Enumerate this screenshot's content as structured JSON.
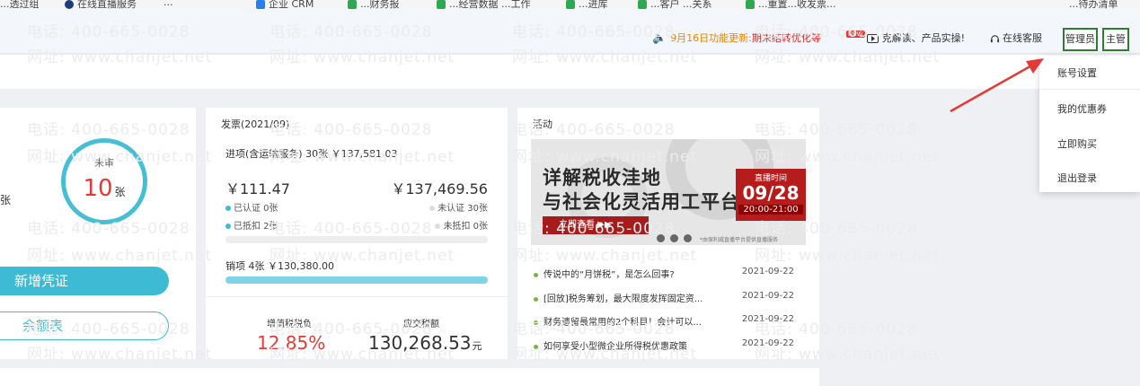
{
  "bookmarks": {
    "items": [
      "...透过组",
      "在线直播服务",
      "...",
      "企业 CRM",
      "...财务报",
      "...经营数据 ...工作",
      "...进库",
      "...客户 ...关系",
      "...重置...收发票..."
    ],
    "right_label": "...待办清单"
  },
  "header": {
    "notice_prefix": "9月16日功能更新:",
    "notice_highlight": "期末结转优化等",
    "promo_badge": "NEW",
    "promo_text": "克解读、产品实操!",
    "service_label": "在线客服",
    "role_admin": "管理员",
    "role_lead": "主管"
  },
  "account_menu": {
    "items": [
      "账号设置",
      "我的优惠券",
      "立即购买",
      "退出登录"
    ]
  },
  "voucher_card": {
    "left_fragment": "张",
    "circle_label": "未审",
    "count": "10",
    "count_unit": "张",
    "new_voucher_button": "新增凭证",
    "balance_button": "余额表"
  },
  "invoice_card": {
    "title": "发票(2021/09)",
    "input_line": "进项(含运输服务) 30张 ￥137,581.03",
    "amount_left": "￥111.47",
    "amount_right": "￥137,469.56",
    "stat_certified": "已认证  0张",
    "stat_uncertified": "未认证  30张",
    "stat_deducted": "已抵扣  2张",
    "stat_undeducted": "未抵扣  0张",
    "output_line": "销项    4张    ￥130,380.00",
    "vat_label": "增值税税负",
    "vat_value": "12.85%",
    "tax_due_label": "应交税额",
    "tax_due_value": "130,268.53",
    "tax_due_unit": "元"
  },
  "activity_card": {
    "title": "活动",
    "banner": {
      "line1": "详解税收洼地",
      "line2": "与社会化灵活用工平台",
      "button": "立即查看 ▶▶",
      "live_label": "直播时间",
      "live_date": "09/28",
      "live_time": "20:00-21:00",
      "note": "*由保利威直播平台提供直播服务"
    },
    "news": [
      {
        "title": "传说中的“月饼税”，是怎么回事?",
        "date": "2021-09-22"
      },
      {
        "title": "[回放]税务筹划，最大限度发挥固定资...",
        "date": "2021-09-22"
      },
      {
        "title": "财务遗留最常用的2个科目！会计可以...",
        "date": "2021-09-22"
      },
      {
        "title": "如何享受小型微企业所得税优惠政策",
        "date": "2021-09-22"
      }
    ]
  },
  "watermark": {
    "phone": "电话: 400-665-0028",
    "site": "网址: www.chanjet.net"
  },
  "colors": {
    "accent": "#3dbbd4",
    "danger": "#e53935",
    "notice": "#f08300",
    "role_border": "#2e7d32",
    "arrow": "#e53935"
  }
}
